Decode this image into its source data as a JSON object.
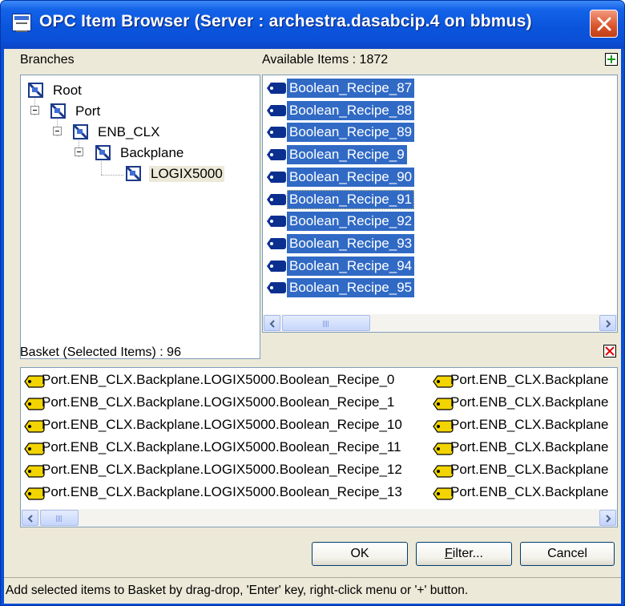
{
  "window": {
    "title": "OPC Item Browser (Server : archestra.dasabcip.4 on bbmus)"
  },
  "branches": {
    "label": "Branches",
    "tree": [
      {
        "label": "Root",
        "level": 0
      },
      {
        "label": "Port",
        "level": 1
      },
      {
        "label": "ENB_CLX",
        "level": 2
      },
      {
        "label": "Backplane",
        "level": 3
      },
      {
        "label": "LOGIX5000",
        "level": 4,
        "selected": true
      }
    ]
  },
  "available": {
    "label": "Available Items : 1872",
    "items": [
      "Boolean_Recipe_87",
      "Boolean_Recipe_88",
      "Boolean_Recipe_89",
      "Boolean_Recipe_9",
      "Boolean_Recipe_90",
      "Boolean_Recipe_91",
      "Boolean_Recipe_92",
      "Boolean_Recipe_93",
      "Boolean_Recipe_94",
      "Boolean_Recipe_95"
    ],
    "focused_index": 5
  },
  "basket": {
    "label": "Basket (Selected Items) : 96",
    "col1": [
      "Port.ENB_CLX.Backplane.LOGIX5000.Boolean_Recipe_0",
      "Port.ENB_CLX.Backplane.LOGIX5000.Boolean_Recipe_1",
      "Port.ENB_CLX.Backplane.LOGIX5000.Boolean_Recipe_10",
      "Port.ENB_CLX.Backplane.LOGIX5000.Boolean_Recipe_11",
      "Port.ENB_CLX.Backplane.LOGIX5000.Boolean_Recipe_12",
      "Port.ENB_CLX.Backplane.LOGIX5000.Boolean_Recipe_13"
    ],
    "col2": [
      "Port.ENB_CLX.Backplane",
      "Port.ENB_CLX.Backplane",
      "Port.ENB_CLX.Backplane",
      "Port.ENB_CLX.Backplane",
      "Port.ENB_CLX.Backplane",
      "Port.ENB_CLX.Backplane"
    ]
  },
  "buttons": {
    "ok": "OK",
    "filter_hotkey": "F",
    "filter_rest": "ilter...",
    "cancel": "Cancel"
  },
  "status": "Add selected items to Basket by drag-drop, 'Enter' key, right-click menu or '+' button.",
  "colors": {
    "titlebar": "#0a4fd6",
    "selection": "#316ac5",
    "dialog_face": "#ece9d8",
    "close_button": "#d9542c"
  },
  "icons": {
    "title": "app-window-icon",
    "tree_node": "tag-node-icon",
    "item": "tag-item-icon",
    "add": "green-plus-icon",
    "remove": "red-x-icon"
  }
}
